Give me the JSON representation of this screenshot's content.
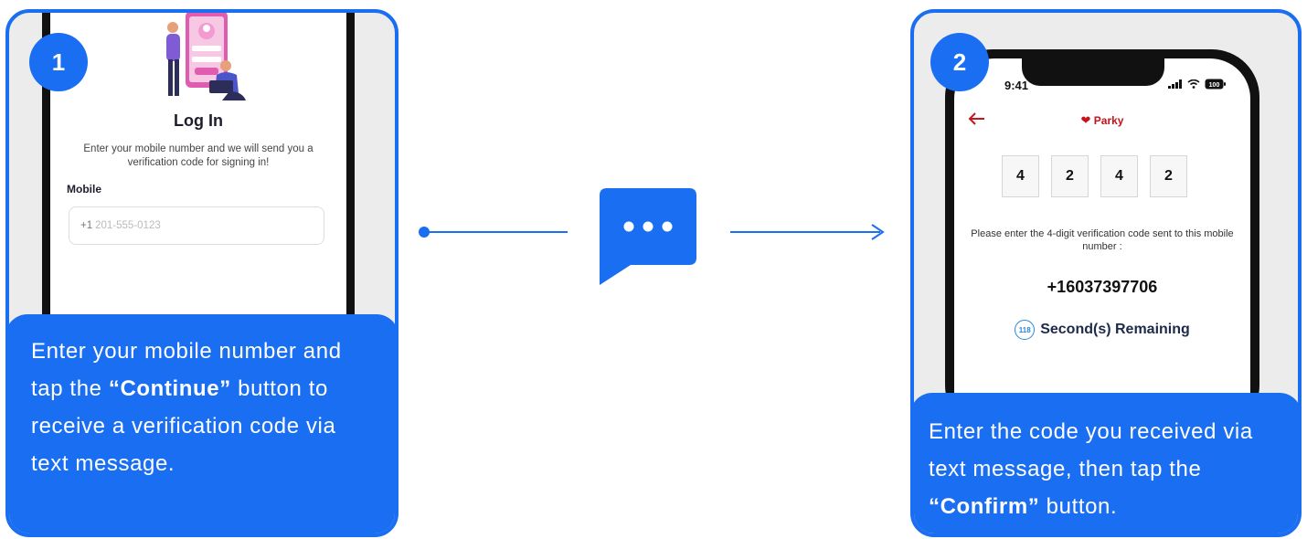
{
  "steps": [
    {
      "number": "1",
      "caption_pre": "Enter your mobile number and tap the ",
      "caption_bold": "“Continue”",
      "caption_post": " button to receive a verification code via text message."
    },
    {
      "number": "2",
      "caption_pre": "Enter the code you received via text message, then tap the ",
      "caption_bold": "“Confirm”",
      "caption_post": " button."
    }
  ],
  "login_screen": {
    "title": "Log In",
    "description": "Enter your mobile number and we will send you a verification code for signing in!",
    "mobile_label": "Mobile",
    "country_code": "+1",
    "phone_placeholder": "201-555-0123"
  },
  "verify_screen": {
    "time": "9:41",
    "battery": "100",
    "brand": "Parky",
    "code_digits": [
      "4",
      "2",
      "4",
      "2"
    ],
    "description": "Please enter the 4-digit verification code sent to this mobile number :",
    "phone_number": "+16037397706",
    "seconds": "118",
    "remaining_label": "Second(s) Remaining"
  },
  "colors": {
    "accent": "#1a6ef2",
    "brand_red": "#c4141c",
    "card_bg": "#ececec"
  },
  "icons": {
    "middle": "chat-bubble-icon",
    "back": "back-arrow-icon",
    "brand": "heart-icon"
  }
}
